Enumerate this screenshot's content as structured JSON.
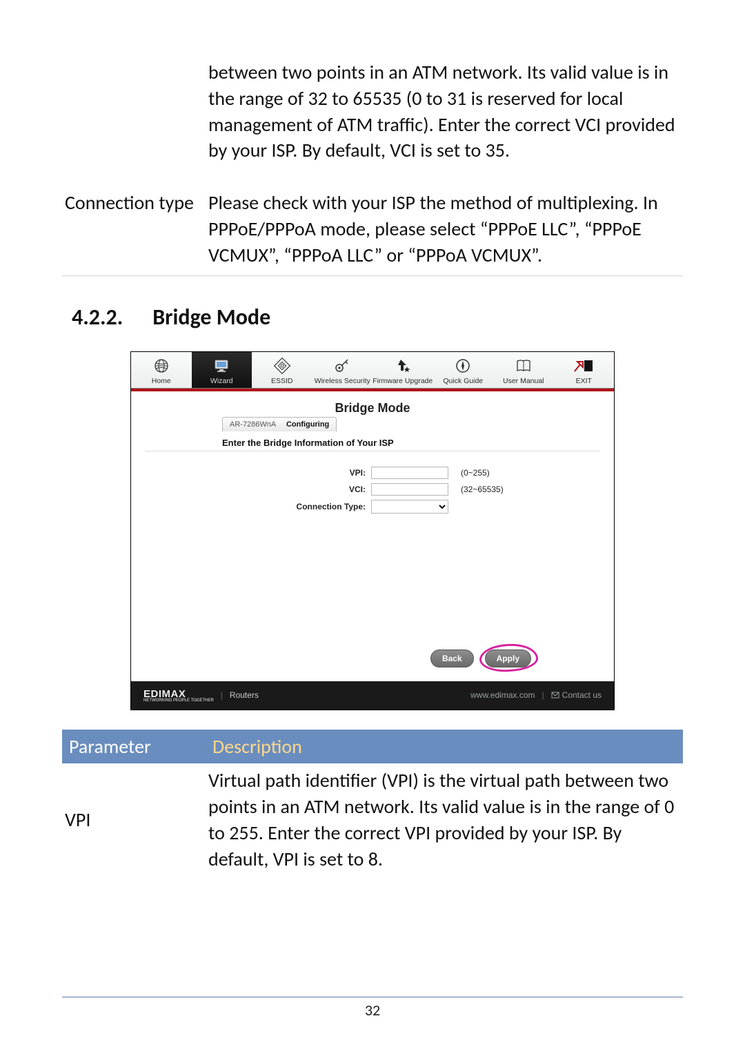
{
  "top_table": {
    "row1_desc": "between two points in an ATM network. Its valid value is in the range of 32 to 65535 (0 to 31 is reserved for local management of ATM traffic). Enter the correct VCI provided by your ISP. By default, VCI is set to 35.",
    "row2_label": "Connection type",
    "row2_desc": "Please check with your ISP the method of multiplexing. In PPPoE/PPPoA mode, please select “PPPoE LLC”, “PPPoE VCMUX”, “PPPoA LLC” or “PPPoA VCMUX”."
  },
  "section": {
    "number": "4.2.2.",
    "title": "Bridge Mode"
  },
  "screenshot": {
    "nav": {
      "home": "Home",
      "wizard": "Wizard",
      "essid": "ESSID",
      "wireless": "Wireless Security",
      "firmware": "Firmware Upgrade",
      "quick": "Quick Guide",
      "manual": "User Manual",
      "exit": "EXIT"
    },
    "title": "Bridge Mode",
    "tab_model": "AR-7286WnA",
    "tab_state": "Configuring",
    "subheading": "Enter the Bridge Information of Your ISP",
    "form": {
      "vpi_label": "VPI:",
      "vpi_hint": "(0~255)",
      "vci_label": "VCI:",
      "vci_hint": "(32~65535)",
      "conn_label": "Connection Type:"
    },
    "buttons": {
      "back": "Back",
      "apply": "Apply"
    },
    "footer": {
      "brand": "EDIMAX",
      "brand_tag": "NETWORKING PEOPLE TOGETHER",
      "category": "Routers",
      "url": "www.edimax.com",
      "contact": "Contact us"
    }
  },
  "bottom_table": {
    "h1": "Parameter",
    "h2": "Description",
    "row1_label": "VPI",
    "row1_desc": "Virtual path identifier (VPI) is the virtual path between two points in an ATM network. Its valid value is in the range of 0 to 255. Enter the correct VPI provided by your ISP. By default, VPI is set to 8."
  },
  "page_number": "32"
}
